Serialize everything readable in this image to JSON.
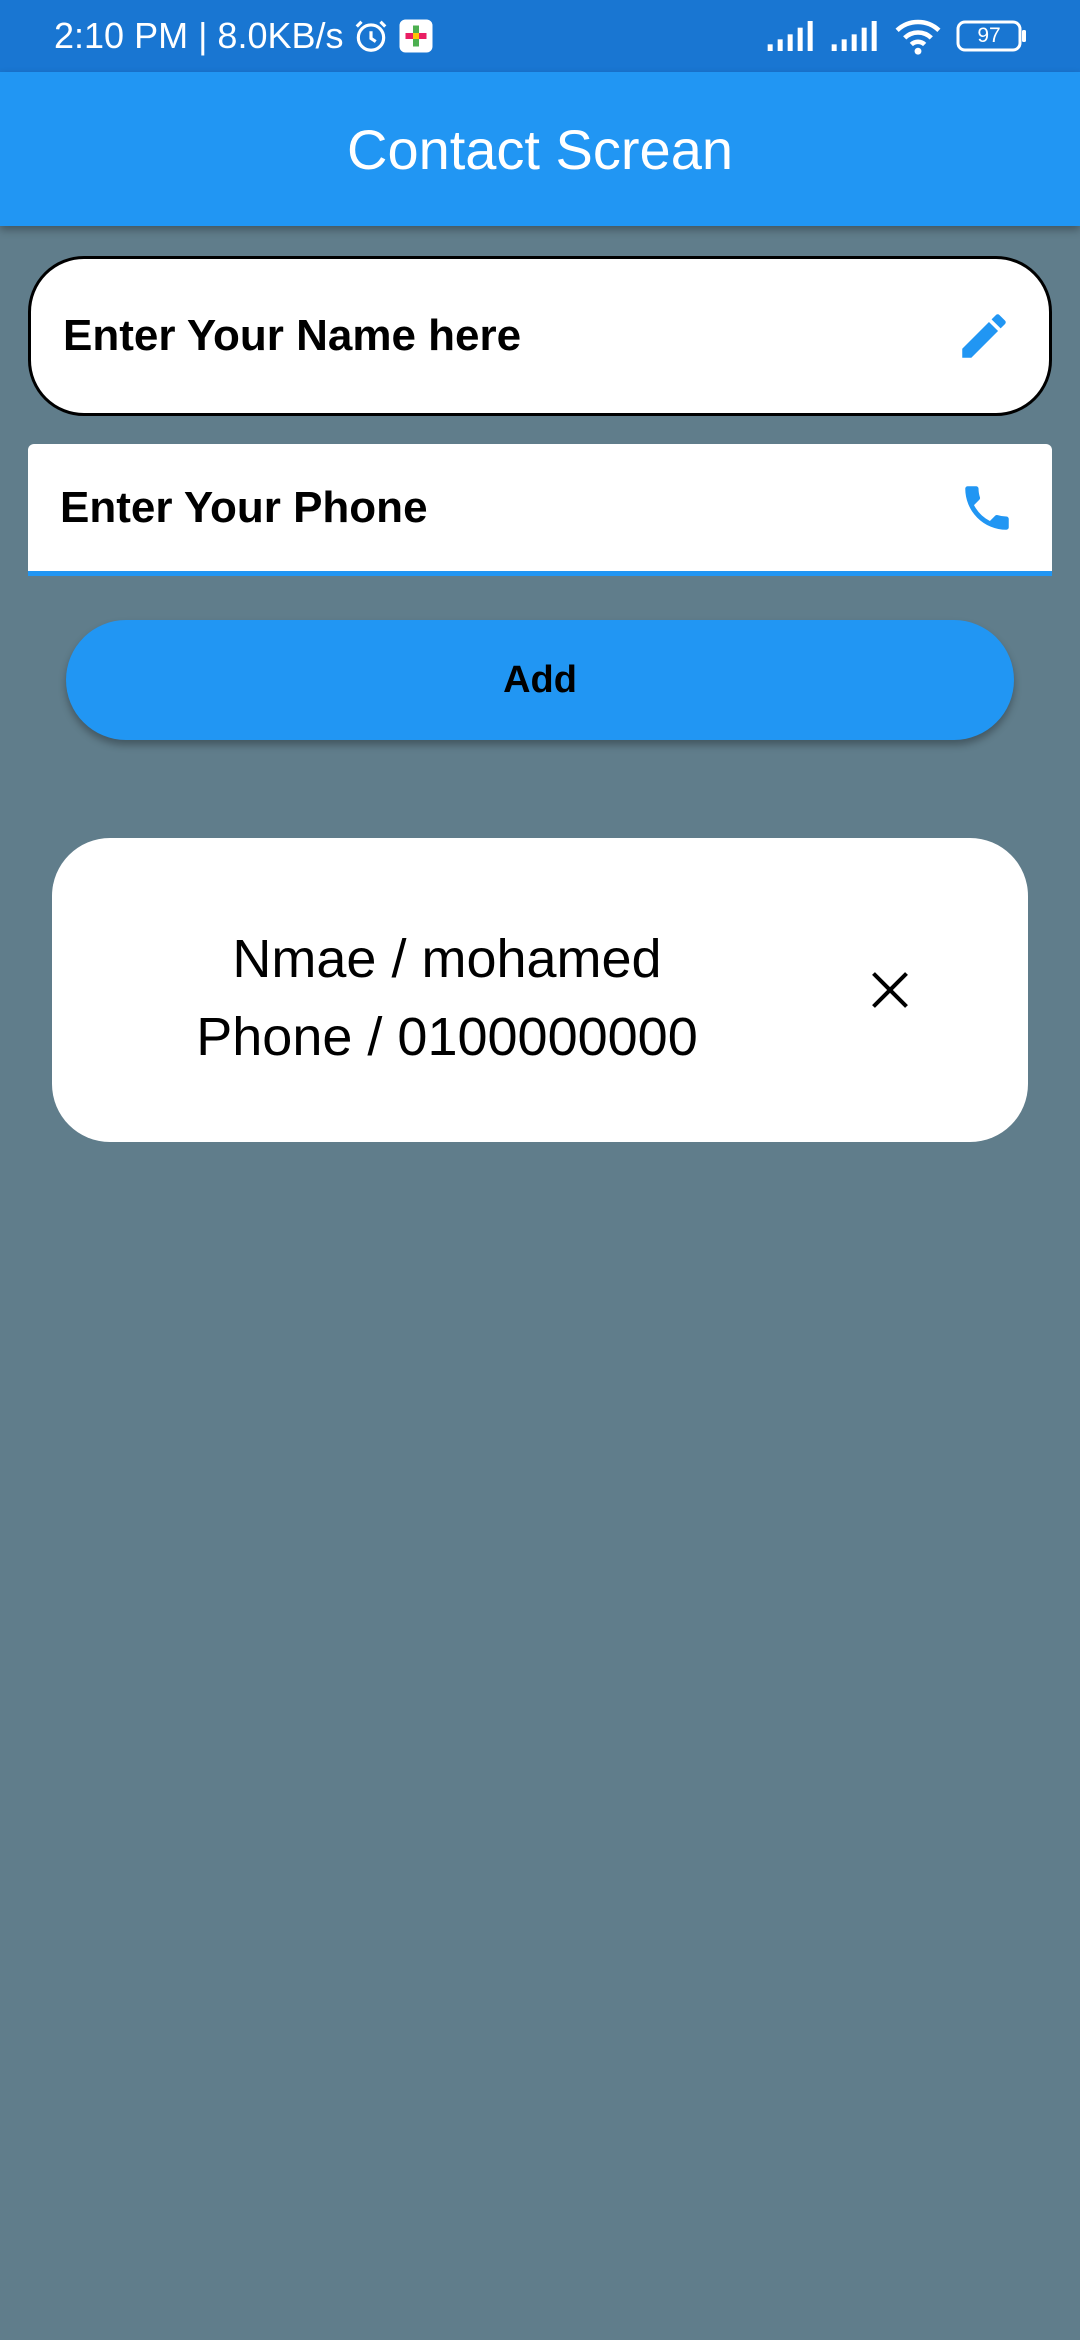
{
  "status_bar": {
    "time_speed": "2:10 PM | 8.0KB/s",
    "battery": "97"
  },
  "icons": {
    "alarm": "alarm-icon",
    "app_notification": "app-notification-icon",
    "signal": "cellular-signal-icon",
    "wifi": "wifi-icon",
    "battery": "battery-icon",
    "edit": "pencil-icon",
    "phone": "phone-icon",
    "delete": "close-icon"
  },
  "colors": {
    "status_bar": "#1976D2",
    "app_bar": "#2196F3",
    "background": "#607D8B",
    "accent": "#2196F3"
  },
  "app_bar": {
    "title": "Contact Screan"
  },
  "form": {
    "name_placeholder": "Enter Your Name here",
    "phone_placeholder": "Enter Your Phone",
    "add_label": "Add"
  },
  "contacts": [
    {
      "name_line": "Nmae / mohamed",
      "phone_line": "Phone / 0100000000"
    }
  ]
}
